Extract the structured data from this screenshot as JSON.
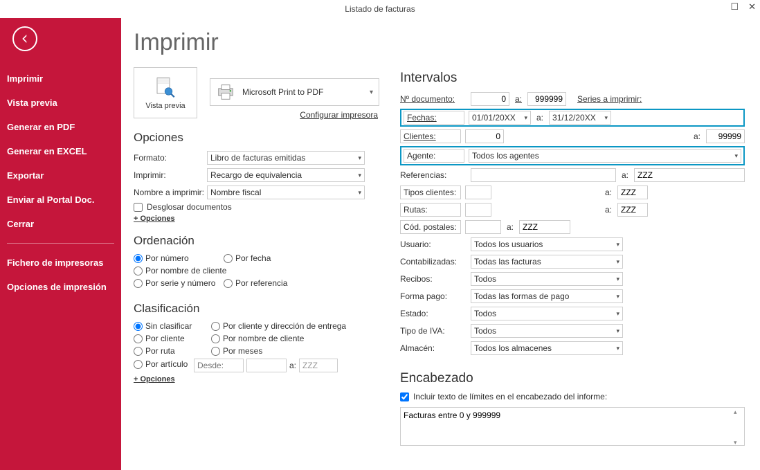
{
  "window": {
    "title": "Listado de facturas"
  },
  "sidebar": {
    "items": [
      "Imprimir",
      "Vista previa",
      "Generar en PDF",
      "Generar en EXCEL",
      "Exportar",
      "Enviar al Portal Doc.",
      "Cerrar"
    ],
    "items2": [
      "Fichero de impresoras",
      "Opciones de impresión"
    ]
  },
  "page": {
    "title": "Imprimir",
    "vista_previa": "Vista previa",
    "printer": "Microsoft Print to PDF",
    "configurar": "Configurar impresora"
  },
  "opciones": {
    "heading": "Opciones",
    "formato_lbl": "Formato:",
    "formato": "Libro de facturas emitidas",
    "imprimir_lbl": "Imprimir:",
    "imprimir": "Recargo de equivalencia",
    "nombre_lbl": "Nombre a imprimir:",
    "nombre": "Nombre fiscal",
    "desglosar": "Desglosar documentos",
    "more": "+ Opciones"
  },
  "ordenacion": {
    "heading": "Ordenación",
    "r1": "Por número",
    "r2": "Por fecha",
    "r3": "Por nombre de cliente",
    "r4": "Por serie y número",
    "r5": "Por referencia"
  },
  "clasificacion": {
    "heading": "Clasificación",
    "r1": "Sin clasificar",
    "r2": "Por cliente y dirección de entrega",
    "r3": "Por cliente",
    "r4": "Por nombre de cliente",
    "r5": "Por ruta",
    "r6": "Por meses",
    "r7": "Por artículo",
    "desde": "Desde:",
    "a": "a:",
    "a_val": "ZZZ",
    "more": "+ Opciones"
  },
  "intervalos": {
    "heading": "Intervalos",
    "ndoc_lbl": "Nº documento:",
    "ndoc_from": "0",
    "ndoc_a": "a:",
    "ndoc_to": "999999",
    "series": "Series a imprimir:",
    "fechas_lbl": "Fechas:",
    "fechas_from": "01/01/20XX",
    "fechas_a": "a:",
    "fechas_to": "31/12/20XX",
    "clientes_lbl": "Clientes:",
    "clientes_from": "0",
    "clientes_a": "a:",
    "clientes_to": "99999",
    "agente_lbl": "Agente:",
    "agente": "Todos los agentes",
    "ref_lbl": "Referencias:",
    "ref_a": "a:",
    "ref_to": "ZZZ",
    "tipos_lbl": "Tipos clientes:",
    "tipos_a": "a:",
    "tipos_to": "ZZZ",
    "rutas_lbl": "Rutas:",
    "rutas_a": "a:",
    "rutas_to": "ZZZ",
    "cp_lbl": "Cód. postales:",
    "cp_a": "a:",
    "cp_to": "ZZZ",
    "usuario_lbl": "Usuario:",
    "usuario": "Todos los usuarios",
    "cont_lbl": "Contabilizadas:",
    "cont": "Todas las facturas",
    "rec_lbl": "Recibos:",
    "rec": "Todos",
    "fp_lbl": "Forma pago:",
    "fp": "Todas las formas de pago",
    "estado_lbl": "Estado:",
    "estado": "Todos",
    "iva_lbl": "Tipo de IVA:",
    "iva": "Todos",
    "alm_lbl": "Almacén:",
    "alm": "Todos los almacenes"
  },
  "encabezado": {
    "heading": "Encabezado",
    "chk": "Incluir texto de límites en el encabezado del informe:",
    "text": "Facturas entre 0 y 999999"
  }
}
